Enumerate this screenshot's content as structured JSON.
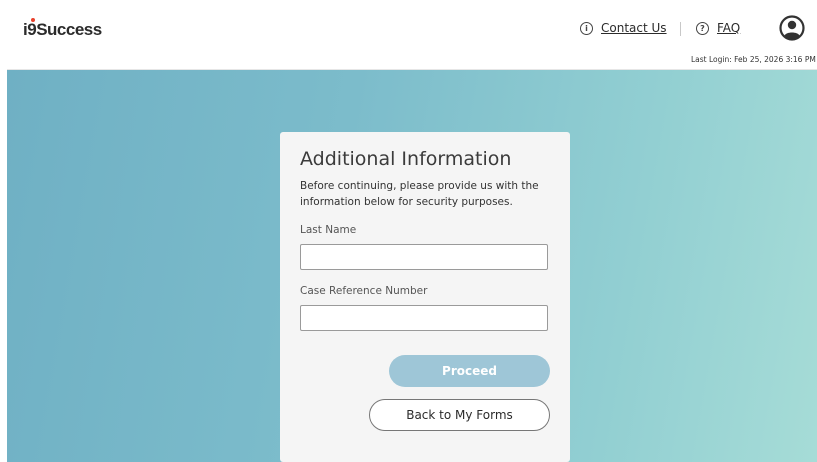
{
  "header": {
    "logo_prefix": "i",
    "logo_nine": "9",
    "logo_suffix": "Success",
    "contact_label": "Contact Us",
    "faq_label": "FAQ",
    "last_login": "Last Login: Feb 25, 2026 3:16 PM"
  },
  "icons": {
    "info": "info-circle-icon",
    "help": "question-circle-icon",
    "avatar": "user-avatar-icon"
  },
  "card": {
    "title": "Additional Information",
    "description": "Before continuing, please provide us with the information below for security purposes.",
    "last_name_label": "Last Name",
    "last_name_value": "",
    "case_ref_label": "Case Reference Number",
    "case_ref_value": "",
    "proceed_label": "Proceed",
    "back_label": "Back to My Forms"
  },
  "colors": {
    "proceed_bg": "#9ec6d7",
    "background_start": "#6fb0c4",
    "background_end": "#a6dcd7",
    "logo_dot": "#e8412c"
  }
}
